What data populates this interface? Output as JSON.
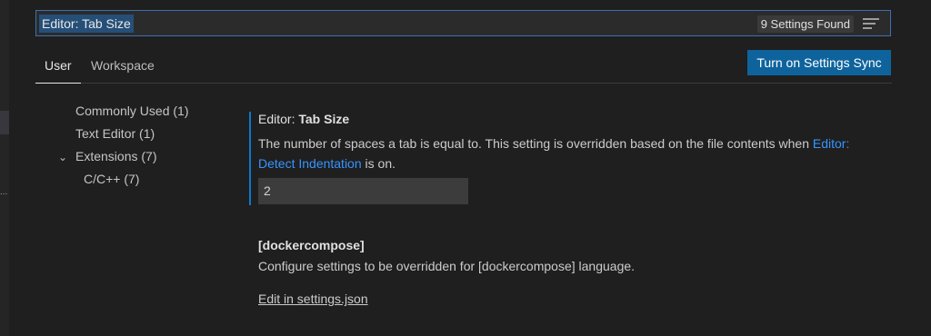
{
  "search": {
    "query": "Editor: Tab Size",
    "result_count": "9 Settings Found",
    "filter_icon": "filter-lines-icon"
  },
  "tabs": [
    {
      "label": "User",
      "active": true
    },
    {
      "label": "Workspace",
      "active": false
    }
  ],
  "sync_button_label": "Turn on Settings Sync",
  "toc": [
    {
      "label": "Commonly Used (1)",
      "level": 0
    },
    {
      "label": "Text Editor (1)",
      "level": 0
    },
    {
      "label": "Extensions (7)",
      "level": 0,
      "expanded": true,
      "icon": "chevron-down-icon"
    },
    {
      "label": "C/C++ (7)",
      "level": 1
    }
  ],
  "setting": {
    "category": "Editor: ",
    "name": "Tab Size",
    "description_before": "The number of spaces a tab is equal to. This setting is overridden based on the file contents when ",
    "link_text": "Editor: Detect Indentation",
    "description_after": " is on.",
    "value": "2"
  },
  "language_setting": {
    "title": "[dockercompose]",
    "description": "Configure settings to be overridden for [dockercompose] language.",
    "link_label": "Edit in settings.json"
  },
  "colors": {
    "background": "#1f1f1f",
    "accent": "#0e639c",
    "link": "#3794ff",
    "focus_border": "#0a7acc"
  }
}
